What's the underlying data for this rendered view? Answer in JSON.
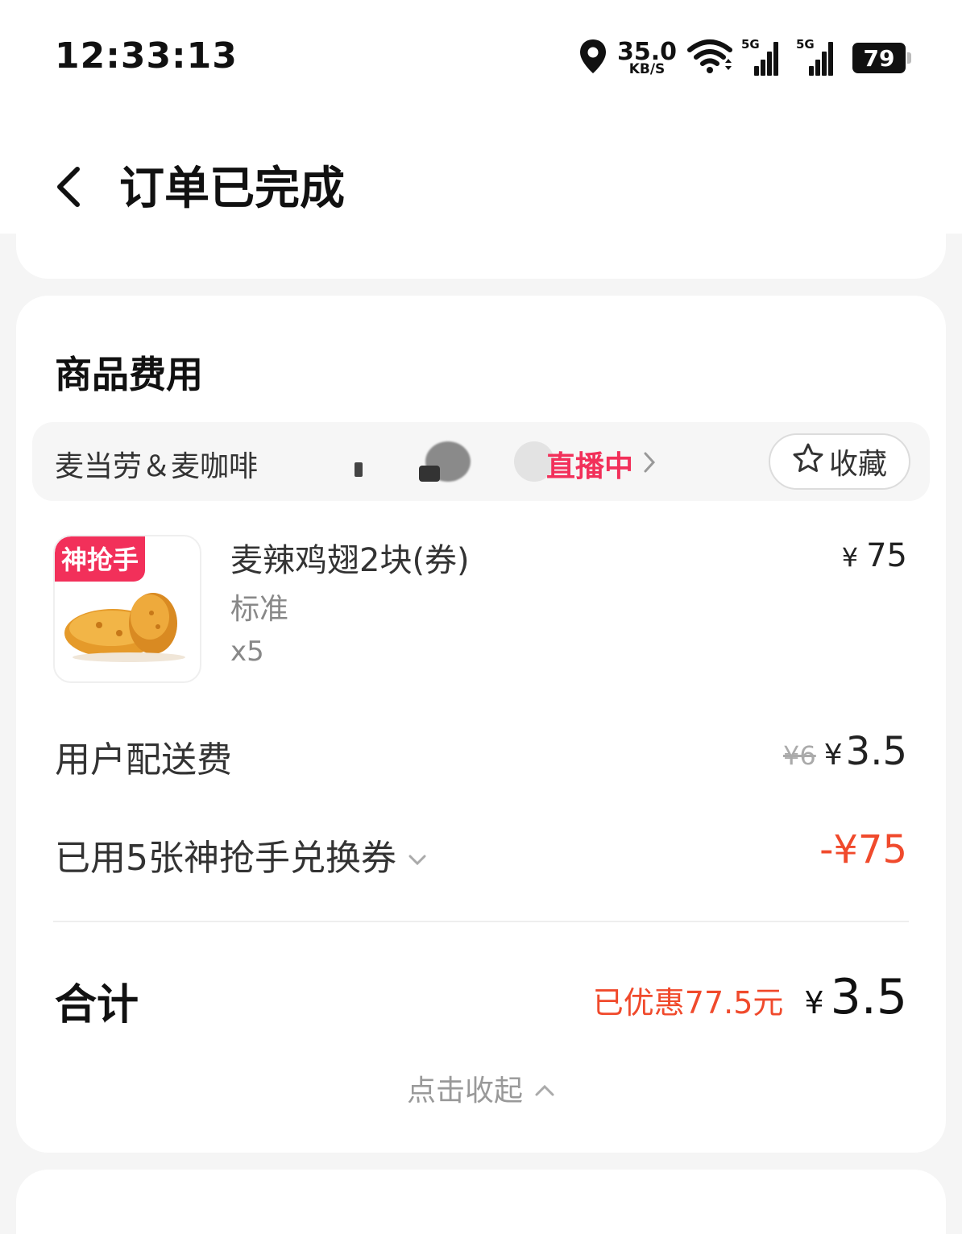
{
  "status_bar": {
    "time": "12:33:13",
    "net_speed_value": "35.0",
    "net_speed_unit": "KB/S",
    "sim1_label": "5G",
    "sim2_label": "5G",
    "battery": "79"
  },
  "header": {
    "title": "订单已完成"
  },
  "fees": {
    "section_title": "商品费用",
    "store": {
      "name": "麦当劳＆麦咖啡",
      "live_label": "直播中",
      "favorite_label": "收藏"
    },
    "item": {
      "tag": "神抢手",
      "name": "麦辣鸡翅2块(券)",
      "spec": "标准",
      "quantity": "x5",
      "price_currency": "¥",
      "price": "75"
    },
    "delivery": {
      "label": "用户配送费",
      "original": "¥6",
      "currency": "¥",
      "amount": "3.5"
    },
    "coupon": {
      "label": "已用5张神抢手兑换券",
      "amount": "-¥75"
    },
    "total": {
      "label": "合计",
      "saved": "已优惠77.5元",
      "currency": "¥",
      "amount": "3.5"
    },
    "collapse_label": "点击收起"
  },
  "colors": {
    "accent_pink": "#f2305a",
    "discount_red": "#f04a2c"
  }
}
